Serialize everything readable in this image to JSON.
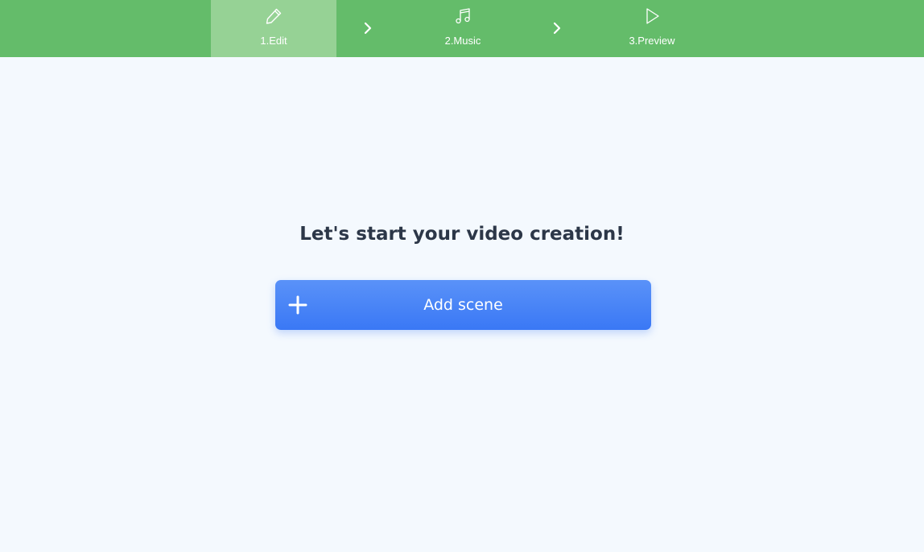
{
  "steps": [
    {
      "label": "1.Edit",
      "icon": "pencil-icon",
      "active": true
    },
    {
      "label": "2.Music",
      "icon": "music-note-icon",
      "active": false
    },
    {
      "label": "3.Preview",
      "icon": "play-icon",
      "active": false
    }
  ],
  "main": {
    "title": "Let's start your video creation!",
    "add_button_label": "Add scene"
  },
  "colors": {
    "topbar": "#64bc6a",
    "active_step": "#96d295",
    "background": "#f4f9fe",
    "button": "#3a78f5",
    "title_text": "#2c3748"
  }
}
